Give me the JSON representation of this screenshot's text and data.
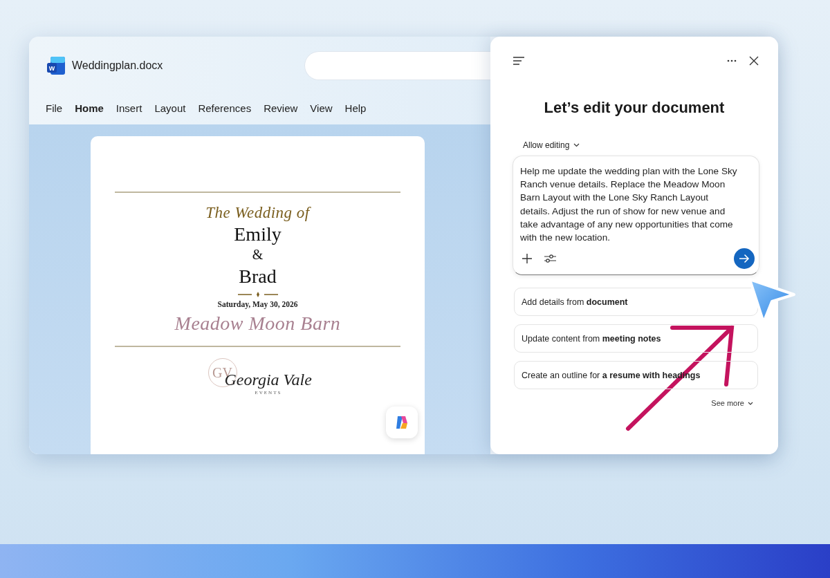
{
  "window": {
    "title": "Weddingplan.docx",
    "app_icon_letter": "W"
  },
  "menu": [
    {
      "label": "File",
      "selected": false
    },
    {
      "label": "Home",
      "selected": true
    },
    {
      "label": "Insert",
      "selected": false
    },
    {
      "label": "Layout",
      "selected": false
    },
    {
      "label": "References",
      "selected": false
    },
    {
      "label": "Review",
      "selected": false
    },
    {
      "label": "View",
      "selected": false
    },
    {
      "label": "Help",
      "selected": false
    }
  ],
  "document": {
    "title_line": "The Wedding of",
    "name_1": "Emily",
    "ampersand": "&",
    "name_2": "Brad",
    "date": "Saturday, May 30, 2026",
    "venue": "Meadow Moon Barn",
    "logo": {
      "monogram": "GV",
      "name": "Georgia Vale",
      "tagline": "EVENTS"
    }
  },
  "copilot": {
    "heading": "Let’s edit your document",
    "mode": "Allow editing",
    "prompt": "Help me update the wedding plan with the Lone Sky Ranch venue details. Replace the Meadow Moon Barn Layout with the Lone Sky Ranch Layout details. Adjust the run of show for new venue and take advantage of any new opportunities that come with the new location.",
    "suggestions": [
      "Add details from **document**",
      "Update content from **meeting notes**",
      "Create an outline for **a resume with headings**"
    ],
    "see_more": "See more"
  }
}
